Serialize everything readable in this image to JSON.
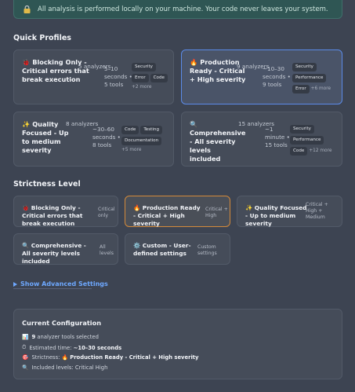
{
  "notice": {
    "icon": "lock-icon",
    "text": "All analysis is performed locally on your machine. Your code never leaves your system."
  },
  "quick_profiles": {
    "heading": "Quick Profiles",
    "cards": [
      {
        "icon": "bug-icon",
        "title": "Blocking Only - Critical errors that break execution",
        "analyzers": "5 analyzers",
        "time": "5–10",
        "time_unit": "seconds •",
        "tools": "5 tools",
        "tags": [
          "Security",
          "Error",
          "Code"
        ],
        "more": "+2 more",
        "selected": false
      },
      {
        "icon": "fire-icon",
        "title": "Production Ready - Critical + High severity",
        "analyzers": "9 analyzers",
        "time": "~10–30",
        "time_unit": "seconds •",
        "tools": "9 tools",
        "tags": [
          "Security",
          "Performance",
          "Error"
        ],
        "more": "+6 more",
        "selected": true
      },
      {
        "icon": "sparkle-icon",
        "title": "Quality Focused - Up to medium severity",
        "analyzers": "8 analyzers",
        "time": "~30–60",
        "time_unit": "seconds •",
        "tools": "8 tools",
        "tags": [
          "Code",
          "Testing",
          "Documentation"
        ],
        "more": "+5 more",
        "selected": false
      },
      {
        "icon": "magnifier-icon",
        "title": "Comprehensive - All severity levels included",
        "analyzers": "15 analyzers",
        "time": "~1",
        "time_unit": "minute •",
        "tools": "15 tools",
        "tags": [
          "Security",
          "Performance",
          "Code"
        ],
        "more": "+12 more",
        "selected": false
      }
    ]
  },
  "strictness": {
    "heading": "Strictness Level",
    "options": [
      {
        "icon": "bug-icon",
        "title": "Blocking Only - Critical errors that break execution",
        "sub": "Critical only"
      },
      {
        "icon": "fire-icon",
        "title": "Production Ready - Critical + High severity",
        "sub": "Critical + High",
        "selected": true
      },
      {
        "icon": "sparkle-icon",
        "title": "Quality Focused - Up to medium severity",
        "sub": "Critical + High + Medium"
      },
      {
        "icon": "magnifier-icon",
        "title": "Comprehensive - All severity levels included",
        "sub": "All levels"
      },
      {
        "icon": "gear-icon",
        "title": "Custom - User-defined settings",
        "sub": "Custom settings"
      }
    ]
  },
  "advanced": {
    "label": "Show Advanced Settings"
  },
  "config": {
    "heading": "Current Configuration",
    "tools_count": "9",
    "tools_text": "analyzer tools selected",
    "time_label": "Estimated time:",
    "time_value": "~10–30 seconds",
    "strictness_label": "Strictness:",
    "strictness_value": "Production Ready - Critical + High severity",
    "levels_label": "Included levels:",
    "levels_value": "Critical High"
  },
  "colors": {
    "accent_blue": "#5b8be8",
    "accent_orange": "#d48a3a",
    "link": "#6ea8ff",
    "notice_bg": "#2f5654"
  }
}
